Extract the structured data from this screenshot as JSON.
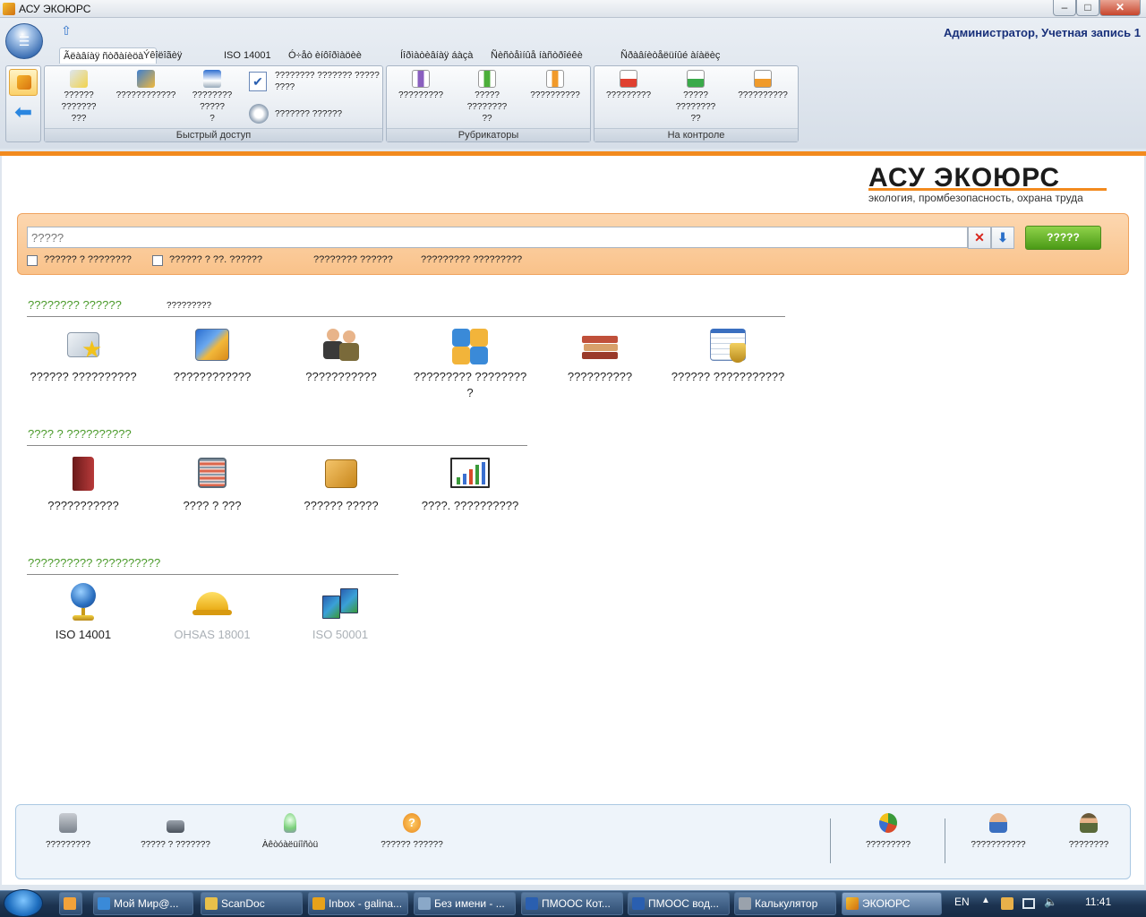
{
  "window": {
    "title": "АСУ ЭКОЮРС"
  },
  "header": {
    "user": "Администратор, Учетная запись 1"
  },
  "tabs": [
    "Ãëàâíàÿ ñòðàíèöà",
    "Ýêîëîãèÿ",
    "ISO 14001",
    "Ó÷åò èíôîðìàöèè",
    "Íîðìàòèâíàÿ áàçà",
    "Ñèñòåìíûå íàñòðîéêè",
    "Ñðàâíèòåëüíûé àíàëèç"
  ],
  "ribbon": {
    "quick_access": {
      "caption": "Быстрый доступ",
      "buttons": [
        "?????? ???????\n???",
        "????????????",
        "???????? ?????\n?"
      ],
      "small_items": [
        "???????? ??????? ?????\n????",
        "??????? ??????"
      ]
    },
    "rubricators": {
      "caption": "Рубрикаторы",
      "buttons": [
        "?????????",
        "????? ????????\n??",
        "??????????"
      ]
    },
    "control": {
      "caption": "На контроле",
      "buttons": [
        "?????????",
        "????? ????????\n??",
        "??????????"
      ]
    }
  },
  "logo": {
    "title": "АСУ ЭКОЮРС",
    "subtitle": "экология, промбезопасность, охрана труда"
  },
  "search": {
    "placeholder": "?????",
    "button": "?????",
    "clear_icon": "close-x-icon",
    "options_icon": "arrow-down-icon",
    "checkbox1": "?????? ? ????????",
    "checkbox2": "?????? ? ??. ??????",
    "link1": "???????? ??????",
    "link2": "????????? ?????????"
  },
  "sections": [
    {
      "title": "???????? ??????",
      "extra": "?????????",
      "tiles": [
        "?????? ??????????",
        "????????????",
        "???????????",
        "????????? ????????\n?",
        "??????????",
        "?????? ???????????"
      ]
    },
    {
      "title": "???? ? ??????????",
      "tiles": [
        "???????????",
        "???? ? ???",
        "?????? ?????",
        "????. ??????????"
      ]
    },
    {
      "title": "?????????? ??????????",
      "tiles": [
        "ISO 14001",
        "OHSAS 18001",
        "ISO 50001"
      ]
    }
  ],
  "bottom": {
    "items": [
      "?????????",
      "????? ? ???????",
      "Àêòóàëüíîñòü",
      "?????? ??????",
      "?????????",
      "???????????",
      "????????"
    ]
  },
  "taskbar": {
    "items": [
      "Мой Мир@...",
      "ScanDoc",
      "Inbox - galina...",
      "Без имени - ...",
      "ПМООС Кот...",
      "ПМООС вод...",
      "Калькулятор",
      "ЭКОЮРС"
    ],
    "lang": "EN",
    "clock": "11:41"
  },
  "colors": {
    "accent": "#f28a1e",
    "section_title": "#4a9a2a",
    "search_button": "#5aa81e",
    "user_text": "#18307a"
  }
}
